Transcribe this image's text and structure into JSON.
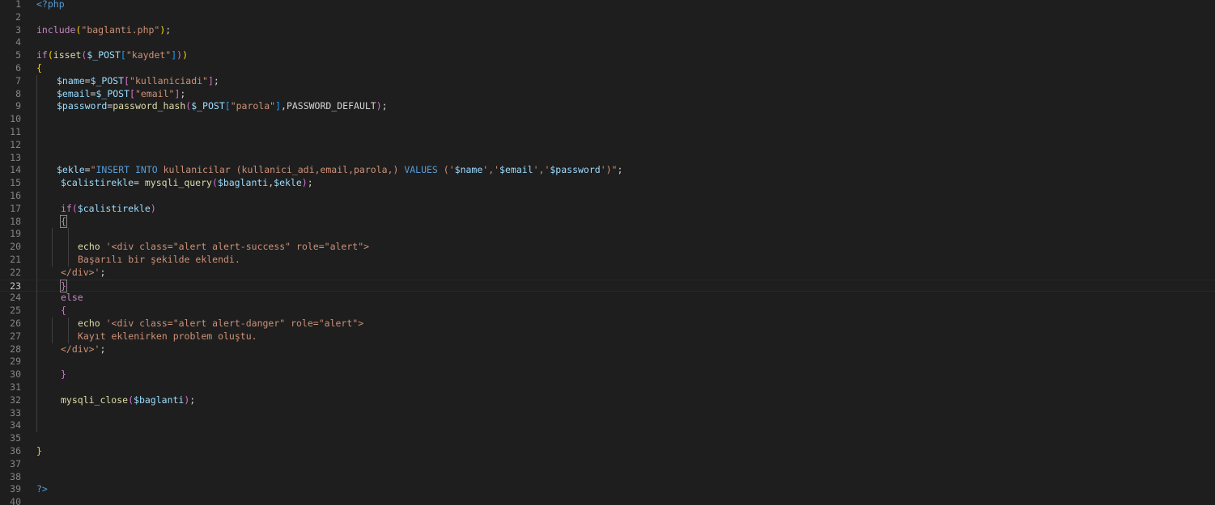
{
  "colors": {
    "background": "#1e1e1e",
    "line_number": "#858585",
    "keyword": "#c586c0",
    "variable": "#9cdcfe",
    "function": "#dcdcaa",
    "string": "#ce9178",
    "bracket_gold": "#ffd700",
    "bracket_purple": "#da70d6",
    "bracket_blue": "#179fff"
  },
  "editor": {
    "current_line": 23,
    "lines": [
      {
        "n": "1",
        "indent": 0,
        "tokens": [
          {
            "t": "<?php",
            "c": "tag"
          }
        ]
      },
      {
        "n": "2",
        "indent": 0,
        "tokens": []
      },
      {
        "n": "3",
        "indent": 0,
        "tokens": [
          {
            "t": "include",
            "c": "kw"
          },
          {
            "t": "(",
            "c": "b1"
          },
          {
            "t": "\"baglanti.php\"",
            "c": "str"
          },
          {
            "t": ")",
            "c": "b1"
          },
          {
            "t": ";",
            "c": "txt"
          }
        ]
      },
      {
        "n": "4",
        "indent": 0,
        "tokens": []
      },
      {
        "n": "5",
        "indent": 0,
        "tokens": [
          {
            "t": "if",
            "c": "kw"
          },
          {
            "t": "(",
            "c": "b1"
          },
          {
            "t": "isset",
            "c": "fn"
          },
          {
            "t": "(",
            "c": "b2"
          },
          {
            "t": "$_POST",
            "c": "var"
          },
          {
            "t": "[",
            "c": "b3"
          },
          {
            "t": "\"kaydet\"",
            "c": "str"
          },
          {
            "t": "]",
            "c": "b3"
          },
          {
            "t": ")",
            "c": "b2"
          },
          {
            "t": ")",
            "c": "b1"
          }
        ]
      },
      {
        "n": "6",
        "indent": 0,
        "tokens": [
          {
            "t": "{",
            "c": "b1"
          }
        ]
      },
      {
        "n": "7",
        "indent": 1,
        "tokens": [
          {
            "t": "$name",
            "c": "var"
          },
          {
            "t": "=",
            "c": "txt"
          },
          {
            "t": "$_POST",
            "c": "var"
          },
          {
            "t": "[",
            "c": "b2"
          },
          {
            "t": "\"kullaniciadi\"",
            "c": "str"
          },
          {
            "t": "]",
            "c": "b2"
          },
          {
            "t": ";",
            "c": "txt"
          }
        ]
      },
      {
        "n": "8",
        "indent": 1,
        "tokens": [
          {
            "t": "$email",
            "c": "var"
          },
          {
            "t": "=",
            "c": "txt"
          },
          {
            "t": "$_POST",
            "c": "var"
          },
          {
            "t": "[",
            "c": "b2"
          },
          {
            "t": "\"email\"",
            "c": "str"
          },
          {
            "t": "]",
            "c": "b2"
          },
          {
            "t": ";",
            "c": "txt"
          }
        ]
      },
      {
        "n": "9",
        "indent": 1,
        "tokens": [
          {
            "t": "$password",
            "c": "var"
          },
          {
            "t": "=",
            "c": "txt"
          },
          {
            "t": "password_hash",
            "c": "fn"
          },
          {
            "t": "(",
            "c": "b2"
          },
          {
            "t": "$_POST",
            "c": "var"
          },
          {
            "t": "[",
            "c": "b3"
          },
          {
            "t": "\"parola\"",
            "c": "str"
          },
          {
            "t": "]",
            "c": "b3"
          },
          {
            "t": ",PASSWORD_DEFAULT",
            "c": "txt"
          },
          {
            "t": ")",
            "c": "b2"
          },
          {
            "t": ";",
            "c": "txt"
          }
        ]
      },
      {
        "n": "10",
        "indent": 1,
        "tokens": []
      },
      {
        "n": "11",
        "indent": 1,
        "tokens": []
      },
      {
        "n": "12",
        "indent": 1,
        "tokens": []
      },
      {
        "n": "13",
        "indent": 1,
        "tokens": []
      },
      {
        "n": "14",
        "indent": 1,
        "tokens": [
          {
            "t": "$ekle",
            "c": "var"
          },
          {
            "t": "=",
            "c": "txt"
          },
          {
            "t": "\"",
            "c": "str"
          },
          {
            "t": "INSERT INTO",
            "c": "sql"
          },
          {
            "t": " kullanicilar (kullanici_adi,email,parola,) ",
            "c": "sqlt"
          },
          {
            "t": "VALUES",
            "c": "sql"
          },
          {
            "t": " ('",
            "c": "sqlt"
          },
          {
            "t": "$name",
            "c": "var"
          },
          {
            "t": "','",
            "c": "sqlt"
          },
          {
            "t": "$email",
            "c": "var"
          },
          {
            "t": "','",
            "c": "sqlt"
          },
          {
            "t": "$password",
            "c": "var"
          },
          {
            "t": "')\"",
            "c": "sqlt"
          },
          {
            "t": ";",
            "c": "txt"
          }
        ]
      },
      {
        "n": "15",
        "indent": 1,
        "extra": 5,
        "tokens": [
          {
            "t": "$calistirekle",
            "c": "var"
          },
          {
            "t": "= ",
            "c": "txt"
          },
          {
            "t": "mysqli_query",
            "c": "fn"
          },
          {
            "t": "(",
            "c": "b2"
          },
          {
            "t": "$baglanti",
            "c": "var"
          },
          {
            "t": ",",
            "c": "txt"
          },
          {
            "t": "$ekle",
            "c": "var"
          },
          {
            "t": ")",
            "c": "b2"
          },
          {
            "t": ";",
            "c": "txt"
          }
        ]
      },
      {
        "n": "16",
        "indent": 1,
        "tokens": []
      },
      {
        "n": "17",
        "indent": 1,
        "extra": 5,
        "tokens": [
          {
            "t": "if",
            "c": "kw"
          },
          {
            "t": "(",
            "c": "b2"
          },
          {
            "t": "$calistirekle",
            "c": "var"
          },
          {
            "t": ")",
            "c": "b2"
          }
        ]
      },
      {
        "n": "18",
        "indent": 1,
        "extra": 5,
        "tokens": [
          {
            "t": "{",
            "c": "bm"
          }
        ]
      },
      {
        "n": "19",
        "indent": 2,
        "tokens": []
      },
      {
        "n": "20",
        "indent": 2,
        "tokens": [
          {
            "t": "echo",
            "c": "fn"
          },
          {
            "t": " '<div class=\"alert alert-success\" role=\"alert\">",
            "c": "str"
          }
        ]
      },
      {
        "n": "21",
        "indent": 2,
        "tokens": [
          {
            "t": "Başarılı bir şekilde eklendi.",
            "c": "str"
          }
        ]
      },
      {
        "n": "22",
        "indent": 1,
        "extra": 5,
        "tokens": [
          {
            "t": "</div>'",
            "c": "str"
          },
          {
            "t": ";",
            "c": "txt"
          }
        ]
      },
      {
        "n": "23",
        "indent": 1,
        "extra": 5,
        "tokens": [
          {
            "t": "}",
            "c": "bm"
          }
        ]
      },
      {
        "n": "24",
        "indent": 1,
        "extra": 5,
        "tokens": [
          {
            "t": "else",
            "c": "kw"
          }
        ]
      },
      {
        "n": "25",
        "indent": 1,
        "extra": 5,
        "tokens": [
          {
            "t": "{",
            "c": "b2"
          }
        ]
      },
      {
        "n": "26",
        "indent": 2,
        "tokens": [
          {
            "t": "echo",
            "c": "fn"
          },
          {
            "t": " '<div class=\"alert alert-danger\" role=\"alert\">",
            "c": "str"
          }
        ]
      },
      {
        "n": "27",
        "indent": 2,
        "tokens": [
          {
            "t": "Kayıt eklenirken problem oluştu.",
            "c": "str"
          }
        ]
      },
      {
        "n": "28",
        "indent": 1,
        "extra": 5,
        "tokens": [
          {
            "t": "</div>'",
            "c": "str"
          },
          {
            "t": ";",
            "c": "txt"
          }
        ]
      },
      {
        "n": "29",
        "indent": 1,
        "tokens": []
      },
      {
        "n": "30",
        "indent": 1,
        "extra": 5,
        "tokens": [
          {
            "t": "}",
            "c": "b2"
          }
        ]
      },
      {
        "n": "31",
        "indent": 1,
        "tokens": []
      },
      {
        "n": "32",
        "indent": 1,
        "extra": 5,
        "tokens": [
          {
            "t": "mysqli_close",
            "c": "fn"
          },
          {
            "t": "(",
            "c": "b2"
          },
          {
            "t": "$baglanti",
            "c": "var"
          },
          {
            "t": ")",
            "c": "b2"
          },
          {
            "t": ";",
            "c": "txt"
          }
        ]
      },
      {
        "n": "33",
        "indent": 1,
        "tokens": []
      },
      {
        "n": "34",
        "indent": 1,
        "tokens": []
      },
      {
        "n": "35",
        "indent": 0,
        "tokens": []
      },
      {
        "n": "36",
        "indent": 0,
        "tokens": [
          {
            "t": "}",
            "c": "b1"
          }
        ]
      },
      {
        "n": "37",
        "indent": 0,
        "tokens": []
      },
      {
        "n": "38",
        "indent": 0,
        "tokens": []
      },
      {
        "n": "39",
        "indent": 0,
        "tokens": [
          {
            "t": "?>",
            "c": "tag"
          }
        ]
      },
      {
        "n": "40",
        "indent": 0,
        "tokens": []
      }
    ]
  }
}
